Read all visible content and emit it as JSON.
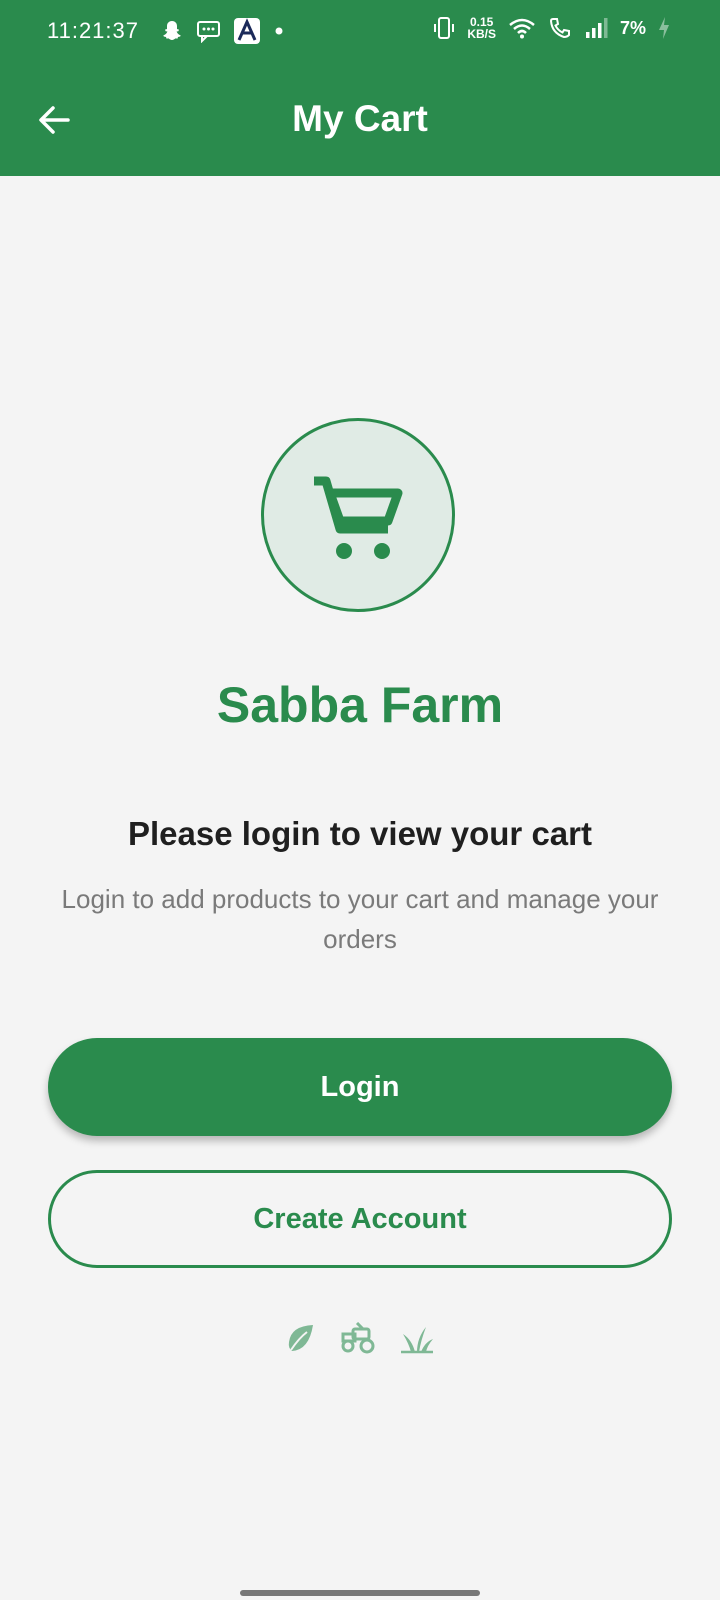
{
  "status_bar": {
    "time": "11:21:37",
    "net_speed_top": "0.15",
    "net_speed_bottom": "KB/S",
    "battery": "7%"
  },
  "toolbar": {
    "title": "My Cart",
    "back_icon": "arrow-left-icon"
  },
  "main": {
    "cart_icon": "shopping-cart-icon",
    "brand": "Sabba Farm",
    "headline": "Please login to view your cart",
    "subtext": "Login to add products to your cart and manage your orders",
    "login_label": "Login",
    "create_account_label": "Create Account",
    "decor_icons": [
      "leaf-icon",
      "tractor-icon",
      "sprout-icon"
    ]
  },
  "colors": {
    "brand_green": "#2a8b4d",
    "background": "#f4f4f4",
    "circle_fill": "#e0ebe5",
    "muted_text": "#7a7a7a"
  }
}
